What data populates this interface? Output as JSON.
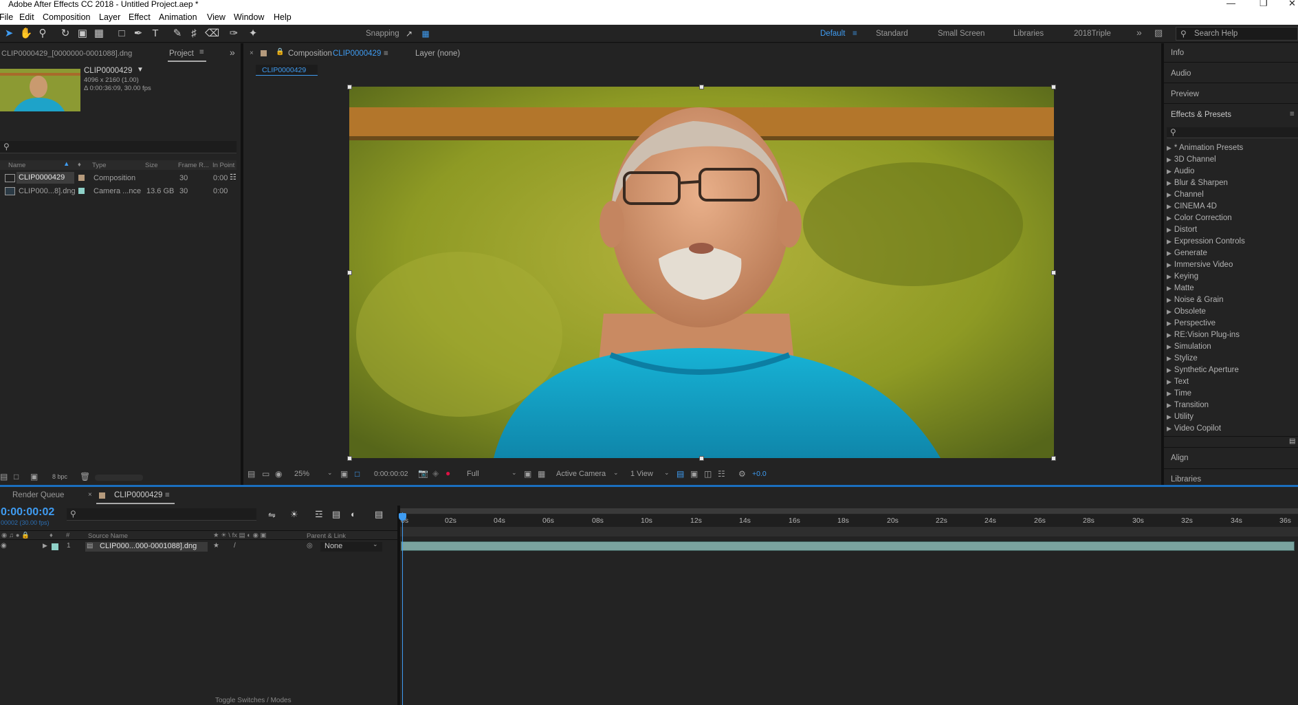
{
  "app": {
    "title": "Adobe After Effects CC 2018 - Untitled Project.aep *"
  },
  "menu": [
    "File",
    "Edit",
    "Composition",
    "Layer",
    "Effect",
    "Animation",
    "View",
    "Window",
    "Help"
  ],
  "toolbar": {
    "snapping_label": "Snapping",
    "workspaces": [
      "Default",
      "Standard",
      "Small Screen",
      "Libraries",
      "2018Triple"
    ],
    "active_workspace": "Default",
    "search_placeholder": "Search Help"
  },
  "project_panel": {
    "header_label": "CLIP0000429_[0000000-0001088].dng",
    "tab_label": "Project",
    "selected_name": "CLIP0000429",
    "selected_size": "4096 x 2160 (1.00)",
    "selected_duration": "Δ 0:00:36:09, 30.00 fps",
    "columns": [
      "Name",
      "Type",
      "Size",
      "Frame R...",
      "In Point"
    ],
    "items": [
      {
        "name": "CLIP0000429",
        "type": "Composition",
        "size": "",
        "frame_rate": "30",
        "in_point": "0:00",
        "label_color": "#b59a7c"
      },
      {
        "name": "CLIP000...8].dng",
        "type": "Camera ...nce",
        "size": "13.6 GB",
        "frame_rate": "30",
        "in_point": "0:00",
        "label_color": "#8fd1c8"
      }
    ],
    "bpc_label": "8 bpc"
  },
  "composition_panel": {
    "tab_prefix": "Composition",
    "comp_name": "CLIP0000429",
    "layer_tab": "Layer (none)",
    "breadcrumb": "CLIP0000429",
    "zoom": "25%",
    "timecode": "0:00:00:02",
    "resolution": "Full",
    "camera": "Active Camera",
    "view": "1 View",
    "exposure": "+0.0"
  },
  "right_panels": {
    "info": "Info",
    "audio": "Audio",
    "preview": "Preview",
    "effects_presets": "Effects & Presets",
    "effects_list": [
      "* Animation Presets",
      "3D Channel",
      "Audio",
      "Blur & Sharpen",
      "Channel",
      "CINEMA 4D",
      "Color Correction",
      "Distort",
      "Expression Controls",
      "Generate",
      "Immersive Video",
      "Keying",
      "Matte",
      "Noise & Grain",
      "Obsolete",
      "Perspective",
      "RE:Vision Plug-ins",
      "Simulation",
      "Stylize",
      "Synthetic Aperture",
      "Text",
      "Time",
      "Transition",
      "Utility",
      "Video Copilot"
    ],
    "align": "Align",
    "libraries": "Libraries"
  },
  "timeline": {
    "render_queue_tab": "Render Queue",
    "comp_tab": "CLIP0000429",
    "current_time": "0:00:00:02",
    "frame_info": "00002 (30.00 fps)",
    "col_source_name": "Source Name",
    "col_parent": "Parent & Link",
    "layer": {
      "index": "1",
      "name": "CLIP000...000-0001088].dng",
      "parent": "None"
    },
    "ruler_labels": [
      "0s",
      "02s",
      "04s",
      "06s",
      "08s",
      "10s",
      "12s",
      "14s",
      "16s",
      "18s",
      "20s",
      "22s",
      "24s",
      "26s",
      "28s",
      "30s",
      "32s",
      "34s",
      "36s"
    ],
    "footer_toggle": "Toggle Switches / Modes"
  },
  "colors": {
    "accent_blue": "#3f9cf2",
    "layer_bar": "#7aa39f"
  }
}
